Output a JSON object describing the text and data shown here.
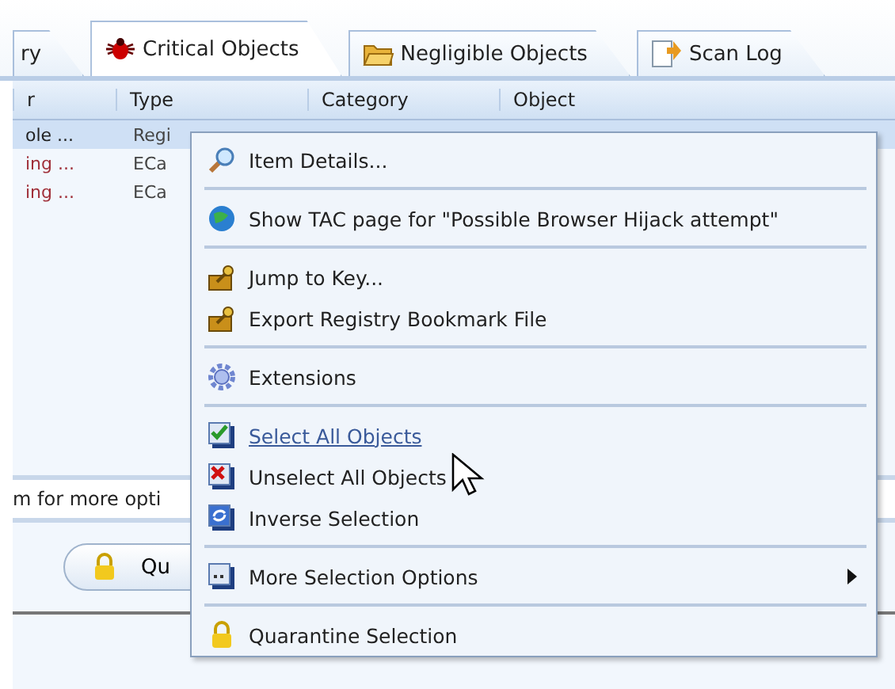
{
  "tabs": [
    {
      "label": "ry",
      "selected": false
    },
    {
      "label": "Critical Objects",
      "selected": true
    },
    {
      "label": "Negligible Objects",
      "selected": false
    },
    {
      "label": "Scan Log",
      "selected": false
    }
  ],
  "table": {
    "columns": [
      "r",
      "Type",
      "Category",
      "Object"
    ],
    "rows": [
      {
        "cells": [
          "ole ...",
          "Regi"
        ],
        "selected": true,
        "critical": false
      },
      {
        "cells": [
          "ing ...",
          "ECa"
        ],
        "selected": false,
        "critical": true
      },
      {
        "cells": [
          "ing ...",
          "ECa"
        ],
        "selected": false,
        "critical": true
      }
    ]
  },
  "hint_bar": {
    "text": "m for more opti"
  },
  "quarantine_button": {
    "label": "Qu"
  },
  "context_menu": {
    "groups": [
      [
        {
          "label": "Item Details...",
          "hovered": false,
          "has_submenu": false
        }
      ],
      [
        {
          "label": "Show TAC page for \"Possible Browser Hijack attempt\"",
          "hovered": false,
          "has_submenu": false
        }
      ],
      [
        {
          "label": "Jump to Key...",
          "hovered": false,
          "has_submenu": false
        },
        {
          "label": "Export Registry Bookmark File",
          "hovered": false,
          "has_submenu": false
        }
      ],
      [
        {
          "label": "Extensions",
          "hovered": false,
          "has_submenu": false
        }
      ],
      [
        {
          "label": "Select All Objects",
          "hovered": true,
          "has_submenu": false
        },
        {
          "label": "Unselect All Objects",
          "hovered": false,
          "has_submenu": false
        },
        {
          "label": "Inverse Selection",
          "hovered": false,
          "has_submenu": false
        }
      ],
      [
        {
          "label": "More Selection Options",
          "hovered": false,
          "has_submenu": true
        }
      ],
      [
        {
          "label": "Quarantine Selection",
          "hovered": false,
          "has_submenu": false
        }
      ]
    ]
  }
}
